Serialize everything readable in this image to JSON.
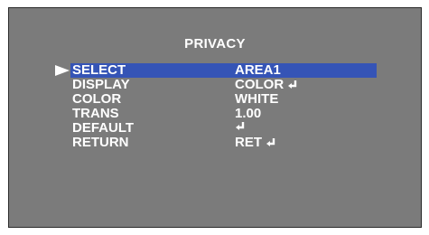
{
  "menu": {
    "title": "PRIVACY",
    "items": [
      {
        "label": "SELECT",
        "value": "AREA1",
        "icon": "",
        "selected": true
      },
      {
        "label": "DISPLAY",
        "value": "COLOR",
        "icon": "enter-icon",
        "selected": false
      },
      {
        "label": "COLOR",
        "value": "WHITE",
        "icon": "",
        "selected": false
      },
      {
        "label": "TRANS",
        "value": "1.00",
        "icon": "",
        "selected": false
      },
      {
        "label": "DEFAULT",
        "value": "",
        "icon": "enter-icon",
        "selected": false
      },
      {
        "label": "RETURN",
        "value": "RET",
        "icon": "enter-icon",
        "selected": false
      }
    ]
  },
  "colors": {
    "background": "#7b7b7b",
    "highlight": "#3554b6",
    "text": "#ffffff"
  }
}
